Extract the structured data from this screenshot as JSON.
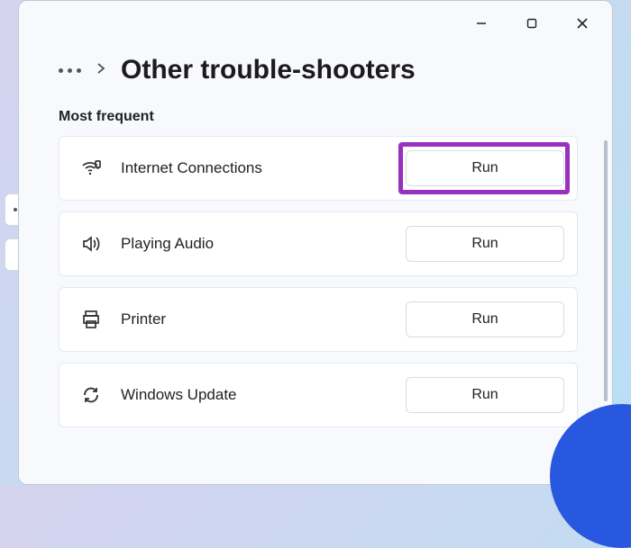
{
  "header": {
    "title": "Other trouble-shooters"
  },
  "section": {
    "most_frequent_label": "Most frequent"
  },
  "actions": {
    "run_label": "Run"
  },
  "items": [
    {
      "label": "Internet Connections",
      "highlighted": true
    },
    {
      "label": "Playing Audio",
      "highlighted": false
    },
    {
      "label": "Printer",
      "highlighted": false
    },
    {
      "label": "Windows Update",
      "highlighted": false
    }
  ]
}
